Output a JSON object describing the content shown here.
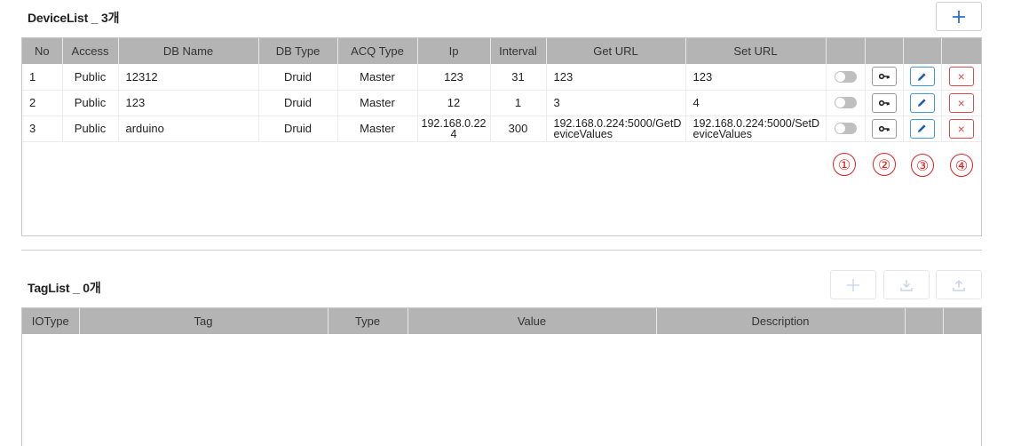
{
  "device_list": {
    "title": "DeviceList _ 3개",
    "add_label": "+",
    "columns": [
      "No",
      "Access",
      "DB Name",
      "DB Type",
      "ACQ Type",
      "Ip",
      "Interval",
      "Get URL",
      "Set URL"
    ],
    "rows": [
      {
        "no": "1",
        "access": "Public",
        "db_name": "12312",
        "db_type": "Druid",
        "acq_type": "Master",
        "ip": "123",
        "interval": "31",
        "get_url": "123",
        "set_url": "123"
      },
      {
        "no": "2",
        "access": "Public",
        "db_name": "123",
        "db_type": "Druid",
        "acq_type": "Master",
        "ip": "12",
        "interval": "1",
        "get_url": "3",
        "set_url": "4"
      },
      {
        "no": "3",
        "access": "Public",
        "db_name": "arduino",
        "db_type": "Druid",
        "acq_type": "Master",
        "ip": "192.168.0.224",
        "interval": "300",
        "get_url": "192.168.0.224:5000/GetDeviceValues",
        "set_url": "192.168.0.224:5000/SetDeviceValues"
      }
    ],
    "annotations": [
      "①",
      "②",
      "③",
      "④"
    ],
    "delete_label": "×"
  },
  "tag_list": {
    "title": "TagList _ 0개",
    "columns": [
      "IOType",
      "Tag",
      "Type",
      "Value",
      "Description"
    ]
  },
  "icons": {
    "add": "plus-icon",
    "import": "download-icon",
    "export": "upload-icon",
    "key": "key-icon",
    "edit": "pencil-icon",
    "delete": "close-icon",
    "toggle": "toggle-switch"
  },
  "colors": {
    "header_bg": "#b4b4b4",
    "edit_blue": "#3d96e6",
    "delete_red": "#e24a4a",
    "annotation_red": "#e32020",
    "add_blue": "#2b6fd6"
  }
}
